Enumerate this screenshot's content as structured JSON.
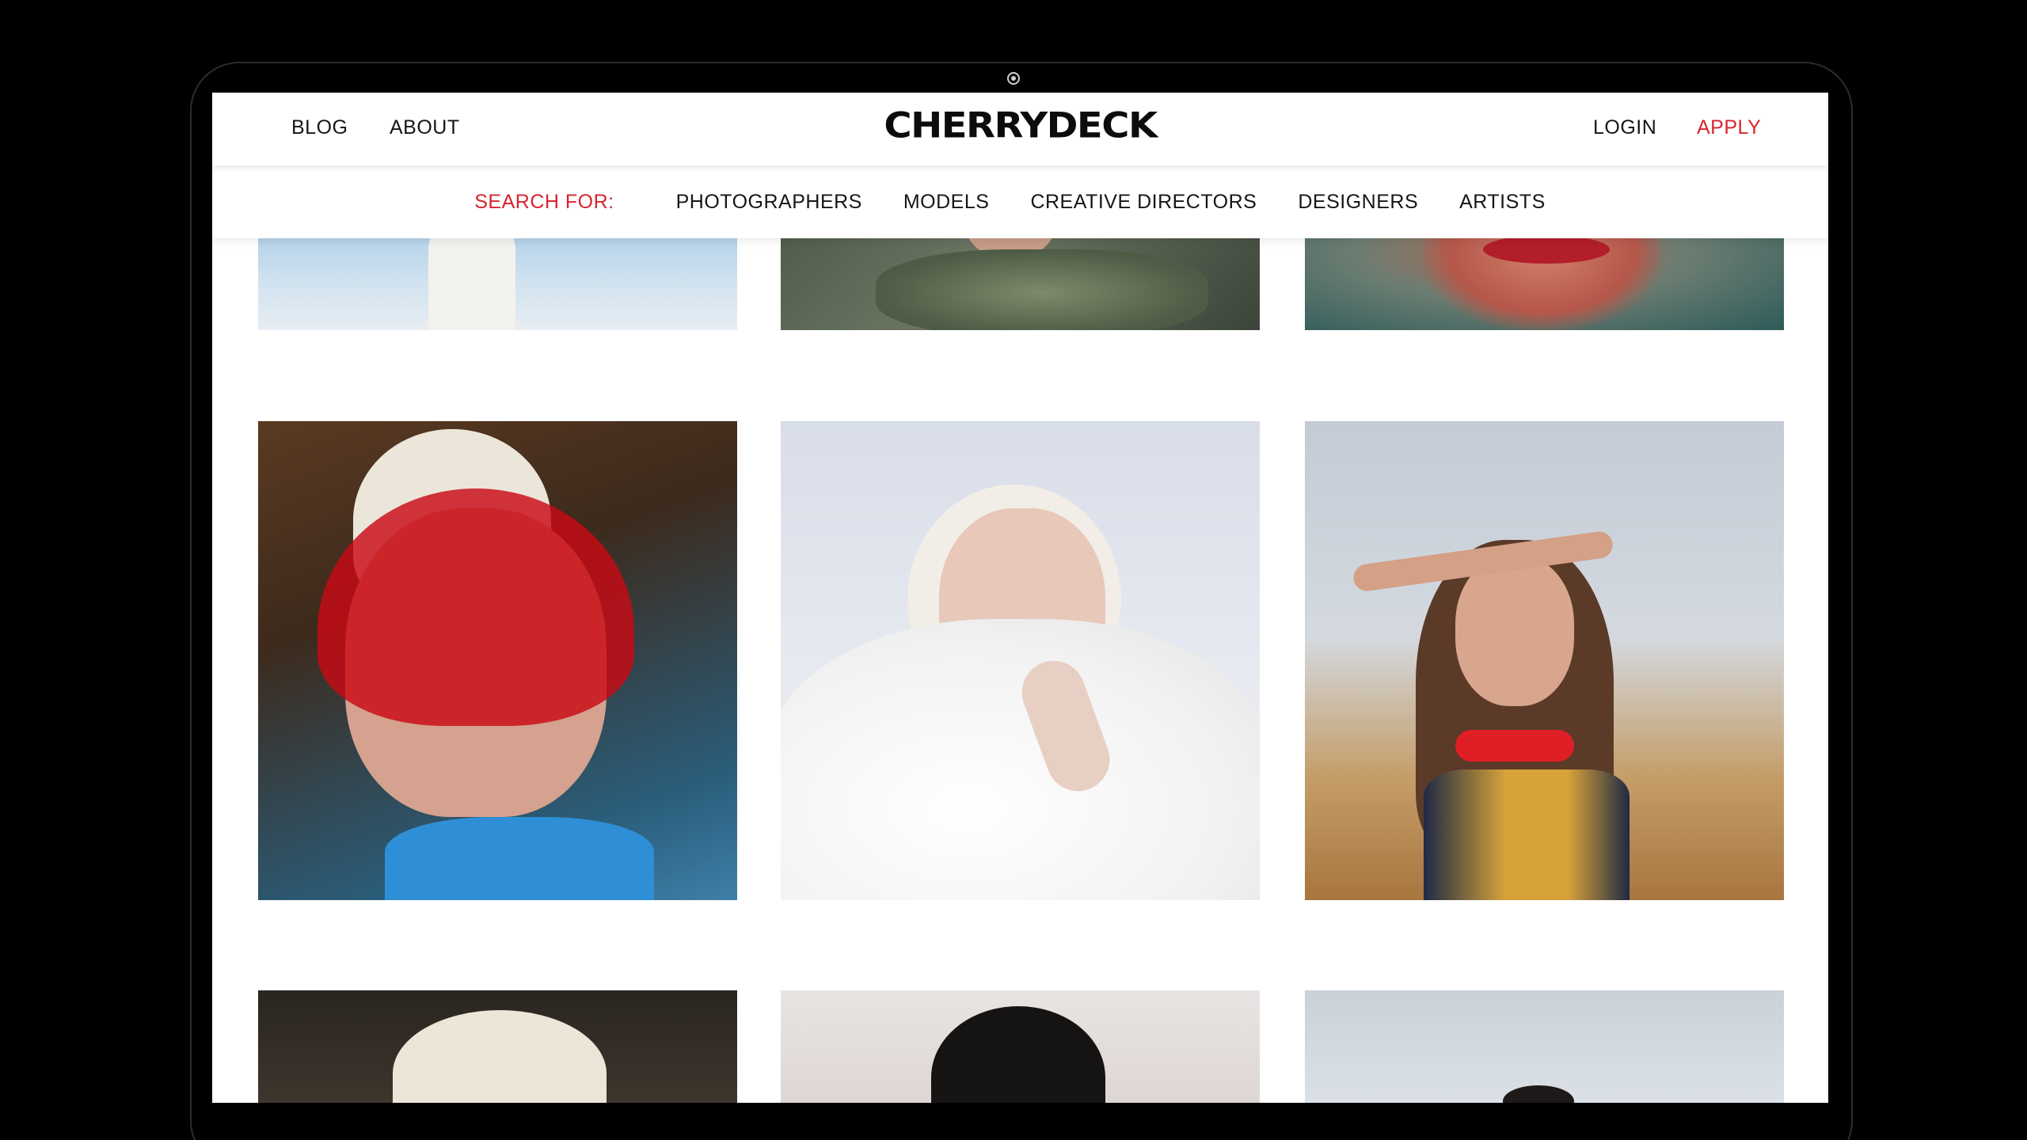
{
  "header": {
    "nav_left": [
      "BLOG",
      "ABOUT"
    ],
    "logo": "CHERRYDECK",
    "nav_right": {
      "login": "LOGIN",
      "apply": "APPLY"
    }
  },
  "search": {
    "label": "SEARCH FOR:",
    "categories": [
      "PHOTOGRAPHERS",
      "MODELS",
      "CREATIVE DIRECTORS",
      "DESIGNERS",
      "ARTISTS"
    ]
  },
  "gallery": {
    "rows": [
      [
        "photo-woman-arms-raised-sky",
        "photo-face-pine-branches",
        "photo-lips-closeup-teal"
      ],
      [
        "photo-elderly-woman-red-visor",
        "photo-platinum-blonde-white-fur",
        "photo-woman-red-scarf-desert"
      ],
      [
        "photo-white-headwrap",
        "photo-dark-hair-portrait",
        "photo-figure-pale-wall"
      ]
    ]
  },
  "colors": {
    "accent": "#d8242f",
    "text": "#161616",
    "frame": "#000000",
    "screen_bg": "#ffffff"
  }
}
